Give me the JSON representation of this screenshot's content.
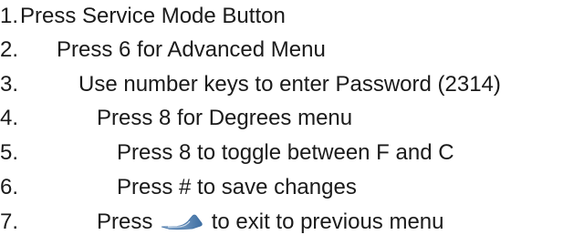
{
  "steps": [
    {
      "number": "1.",
      "text": "Press Service Mode Button"
    },
    {
      "number": "2.",
      "text": "Press 6 for Advanced Menu"
    },
    {
      "number": "3.",
      "text": "Use number keys to enter Password (2314)"
    },
    {
      "number": "4.",
      "text": "Press 8 for Degrees menu"
    },
    {
      "number": "5.",
      "text": "Press 8 to toggle between F and C"
    },
    {
      "number": "6.",
      "text": "Press # to save changes"
    },
    {
      "number": "7.",
      "text_before": "Press",
      "icon": "back-arrow-icon",
      "text_after": "to exit to previous menu"
    }
  ],
  "colors": {
    "text": "#1a1a1a",
    "icon_light": "#9bb8d6",
    "icon_dark": "#3f6fa3"
  }
}
